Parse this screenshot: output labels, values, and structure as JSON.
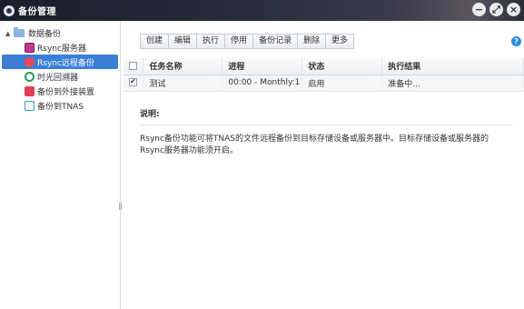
{
  "window": {
    "title": "备份管理",
    "controls": [
      "−",
      "⤢",
      "×"
    ]
  },
  "sidebar": {
    "root": "数据备份",
    "items": [
      {
        "label": "Rsync服务器",
        "icon": "rsync-server-icon"
      },
      {
        "label": "Rsync远程备份",
        "icon": "remote-backup-icon",
        "selected": true
      },
      {
        "label": "时光回溯器",
        "icon": "time-machine-icon"
      },
      {
        "label": "备份到外接装置",
        "icon": "external-device-icon"
      },
      {
        "label": "备份到TNAS",
        "icon": "tnas-icon"
      }
    ]
  },
  "toolbar": {
    "create": "创建",
    "edit": "编辑",
    "run": "执行",
    "disable": "停用",
    "log": "备份记录",
    "delete": "删除",
    "more": "更多"
  },
  "table": {
    "headers": {
      "name": "任务名称",
      "progress": "进程",
      "status": "状态",
      "result": "执行结果"
    },
    "rows": [
      {
        "name": "测试",
        "progress": "00:00 - Monthly:1",
        "status": "启用",
        "result": "准备中..."
      }
    ]
  },
  "description": {
    "title": "说明:",
    "text": "Rsync备份功能可将TNAS的文件远程备份到目标存储设备或服务器中。目标存储设备或服务器的Rsync服务器功能须开启。"
  }
}
